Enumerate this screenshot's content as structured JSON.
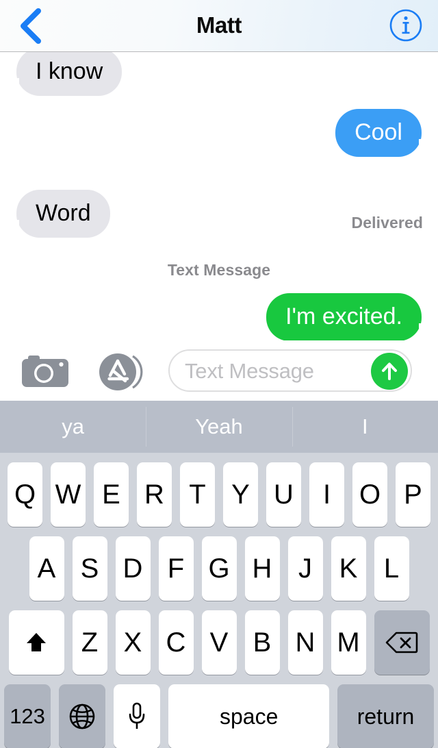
{
  "app": {
    "name": "Messages"
  },
  "navbar": {
    "back_icon": "chevron-left-icon",
    "title": "Matt",
    "info_icon": "info-circle-icon",
    "accent_color": "#1a7df5"
  },
  "conversation": {
    "messages": [
      {
        "text": "I know",
        "side": "incoming",
        "style": "gray"
      },
      {
        "text": "Cool",
        "side": "outgoing",
        "style": "imessage-blue"
      },
      {
        "text": "Word",
        "side": "incoming",
        "style": "gray"
      },
      {
        "text": "I'm excited.",
        "side": "outgoing",
        "style": "sms-green"
      }
    ],
    "delivery_status": "Delivered",
    "divider_label": "Text Message",
    "colors": {
      "incoming_bubble": "#e5e5ea",
      "imessage_blue": "#3b9ef5",
      "sms_green": "#18c83f",
      "status_text": "#8a8a8e"
    }
  },
  "toolbar": {
    "camera_icon": "camera-icon",
    "appstore_icon": "app-store-icon",
    "input_placeholder": "Text Message",
    "input_value": "",
    "send_icon": "arrow-up-icon",
    "send_color": "#1ec943"
  },
  "suggestions": {
    "items": [
      "ya",
      "Yeah",
      "I"
    ],
    "background": "#b8bec9"
  },
  "keyboard": {
    "background": "#d0d4db",
    "rows": {
      "row1": [
        "Q",
        "W",
        "E",
        "R",
        "T",
        "Y",
        "U",
        "I",
        "O",
        "P"
      ],
      "row2": [
        "A",
        "S",
        "D",
        "F",
        "G",
        "H",
        "J",
        "K",
        "L"
      ],
      "row3": [
        "Z",
        "X",
        "C",
        "V",
        "B",
        "N",
        "M"
      ]
    },
    "shift_icon": "shift-arrow-up-icon",
    "delete_icon": "backspace-delete-icon",
    "numeric_label": "123",
    "globe_icon": "globe-language-icon",
    "mic_icon": "microphone-icon",
    "space_label": "space",
    "return_label": "return"
  }
}
